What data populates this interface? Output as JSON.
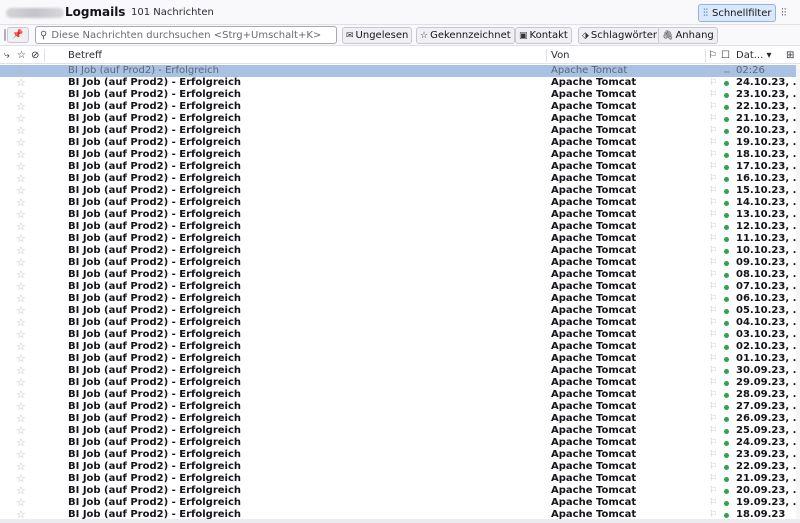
{
  "header": {
    "folder": "Logmails",
    "count": "101 Nachrichten",
    "quickfilter_label": "Schnellfilter",
    "quickfilter_icon": "quick-filter-icon",
    "menu_icon": "display-options-icon"
  },
  "filterbar": {
    "search_placeholder": "Diese Nachrichten durchsuchen <Strg+Umschalt+K>",
    "search_value": "",
    "buttons": [
      {
        "label": "Ungelesen",
        "icon": "envelope-icon"
      },
      {
        "label": "Gekennzeichnet",
        "icon": "star-icon"
      },
      {
        "label": "Kontakt",
        "icon": "contact-icon"
      },
      {
        "label": "Schlagwörter",
        "icon": "tag-icon"
      },
      {
        "label": "Anhang",
        "icon": "paperclip-icon"
      }
    ]
  },
  "columns": {
    "subject": "Betreff",
    "from": "Von",
    "date": "Dat..."
  },
  "colors": {
    "selected_row": "#a9c1e3",
    "unread_dot": "#2fa24a",
    "accent": "#0b57d0"
  },
  "messages": [
    {
      "subject": "BI Job (auf Prod2) - Erfolgreich",
      "from": "Apache Tomcat",
      "date": "02:26",
      "state": "selected"
    },
    {
      "subject": "BI Job (auf Prod2) - Erfolgreich",
      "from": "Apache Tomcat",
      "date": "24.10.23, ...",
      "state": "unread"
    },
    {
      "subject": "BI Job (auf Prod2) - Erfolgreich",
      "from": "Apache Tomcat",
      "date": "23.10.23, ...",
      "state": "unread"
    },
    {
      "subject": "BI Job (auf Prod2) - Erfolgreich",
      "from": "Apache Tomcat",
      "date": "22.10.23, ...",
      "state": "unread"
    },
    {
      "subject": "BI Job (auf Prod2) - Erfolgreich",
      "from": "Apache Tomcat",
      "date": "21.10.23, ...",
      "state": "unread"
    },
    {
      "subject": "BI Job (auf Prod2) - Erfolgreich",
      "from": "Apache Tomcat",
      "date": "20.10.23, ...",
      "state": "unread"
    },
    {
      "subject": "BI Job (auf Prod2) - Erfolgreich",
      "from": "Apache Tomcat",
      "date": "19.10.23, ...",
      "state": "unread"
    },
    {
      "subject": "BI Job (auf Prod2) - Erfolgreich",
      "from": "Apache Tomcat",
      "date": "18.10.23, ...",
      "state": "unread"
    },
    {
      "subject": "BI Job (auf Prod2) - Erfolgreich",
      "from": "Apache Tomcat",
      "date": "17.10.23, ...",
      "state": "unread"
    },
    {
      "subject": "BI Job (auf Prod2) - Erfolgreich",
      "from": "Apache Tomcat",
      "date": "16.10.23, ...",
      "state": "unread"
    },
    {
      "subject": "BI Job (auf Prod2) - Erfolgreich",
      "from": "Apache Tomcat",
      "date": "15.10.23, ...",
      "state": "unread"
    },
    {
      "subject": "BI Job (auf Prod2) - Erfolgreich",
      "from": "Apache Tomcat",
      "date": "14.10.23, ...",
      "state": "unread"
    },
    {
      "subject": "BI Job (auf Prod2) - Erfolgreich",
      "from": "Apache Tomcat",
      "date": "13.10.23, ...",
      "state": "unread"
    },
    {
      "subject": "BI Job (auf Prod2) - Erfolgreich",
      "from": "Apache Tomcat",
      "date": "12.10.23, ...",
      "state": "unread"
    },
    {
      "subject": "BI Job (auf Prod2) - Erfolgreich",
      "from": "Apache Tomcat",
      "date": "11.10.23, ...",
      "state": "unread"
    },
    {
      "subject": "BI Job (auf Prod2) - Erfolgreich",
      "from": "Apache Tomcat",
      "date": "10.10.23, ...",
      "state": "unread"
    },
    {
      "subject": "BI Job (auf Prod2) - Erfolgreich",
      "from": "Apache Tomcat",
      "date": "09.10.23, ...",
      "state": "unread"
    },
    {
      "subject": "BI Job (auf Prod2) - Erfolgreich",
      "from": "Apache Tomcat",
      "date": "08.10.23, ...",
      "state": "unread"
    },
    {
      "subject": "BI Job (auf Prod2) - Erfolgreich",
      "from": "Apache Tomcat",
      "date": "07.10.23, ...",
      "state": "unread"
    },
    {
      "subject": "BI Job (auf Prod2) - Erfolgreich",
      "from": "Apache Tomcat",
      "date": "06.10.23, ...",
      "state": "unread"
    },
    {
      "subject": "BI Job (auf Prod2) - Erfolgreich",
      "from": "Apache Tomcat",
      "date": "05.10.23, ...",
      "state": "unread"
    },
    {
      "subject": "BI Job (auf Prod2) - Erfolgreich",
      "from": "Apache Tomcat",
      "date": "04.10.23, ...",
      "state": "unread"
    },
    {
      "subject": "BI Job (auf Prod2) - Erfolgreich",
      "from": "Apache Tomcat",
      "date": "03.10.23, ...",
      "state": "unread"
    },
    {
      "subject": "BI Job (auf Prod2) - Erfolgreich",
      "from": "Apache Tomcat",
      "date": "02.10.23, ...",
      "state": "unread"
    },
    {
      "subject": "BI Job (auf Prod2) - Erfolgreich",
      "from": "Apache Tomcat",
      "date": "01.10.23, ...",
      "state": "unread"
    },
    {
      "subject": "BI Job (auf Prod2) - Erfolgreich",
      "from": "Apache Tomcat",
      "date": "30.09.23, ...",
      "state": "unread"
    },
    {
      "subject": "BI Job (auf Prod2) - Erfolgreich",
      "from": "Apache Tomcat",
      "date": "29.09.23, ...",
      "state": "unread"
    },
    {
      "subject": "BI Job (auf Prod2) - Erfolgreich",
      "from": "Apache Tomcat",
      "date": "28.09.23, ...",
      "state": "unread"
    },
    {
      "subject": "BI Job (auf Prod2) - Erfolgreich",
      "from": "Apache Tomcat",
      "date": "27.09.23, ...",
      "state": "unread"
    },
    {
      "subject": "BI Job (auf Prod2) - Erfolgreich",
      "from": "Apache Tomcat",
      "date": "26.09.23, ...",
      "state": "unread"
    },
    {
      "subject": "BI Job (auf Prod2) - Erfolgreich",
      "from": "Apache Tomcat",
      "date": "25.09.23, ...",
      "state": "unread"
    },
    {
      "subject": "BI Job (auf Prod2) - Erfolgreich",
      "from": "Apache Tomcat",
      "date": "24.09.23, ...",
      "state": "unread"
    },
    {
      "subject": "BI Job (auf Prod2) - Erfolgreich",
      "from": "Apache Tomcat",
      "date": "23.09.23, ...",
      "state": "unread"
    },
    {
      "subject": "BI Job (auf Prod2) - Erfolgreich",
      "from": "Apache Tomcat",
      "date": "22.09.23, ...",
      "state": "unread"
    },
    {
      "subject": "BI Job (auf Prod2) - Erfolgreich",
      "from": "Apache Tomcat",
      "date": "21.09.23, ...",
      "state": "unread"
    },
    {
      "subject": "BI Job (auf Prod2) - Erfolgreich",
      "from": "Apache Tomcat",
      "date": "20.09.23, ...",
      "state": "unread"
    },
    {
      "subject": "BI Job (auf Prod2) - Erfolgreich",
      "from": "Apache Tomcat",
      "date": "19.09.23, ...",
      "state": "unread"
    },
    {
      "subject": "BI Job (auf Prod2) - Erfolgreich",
      "from": "Apache Tomcat",
      "date": "18.09.23",
      "state": "unread"
    }
  ]
}
